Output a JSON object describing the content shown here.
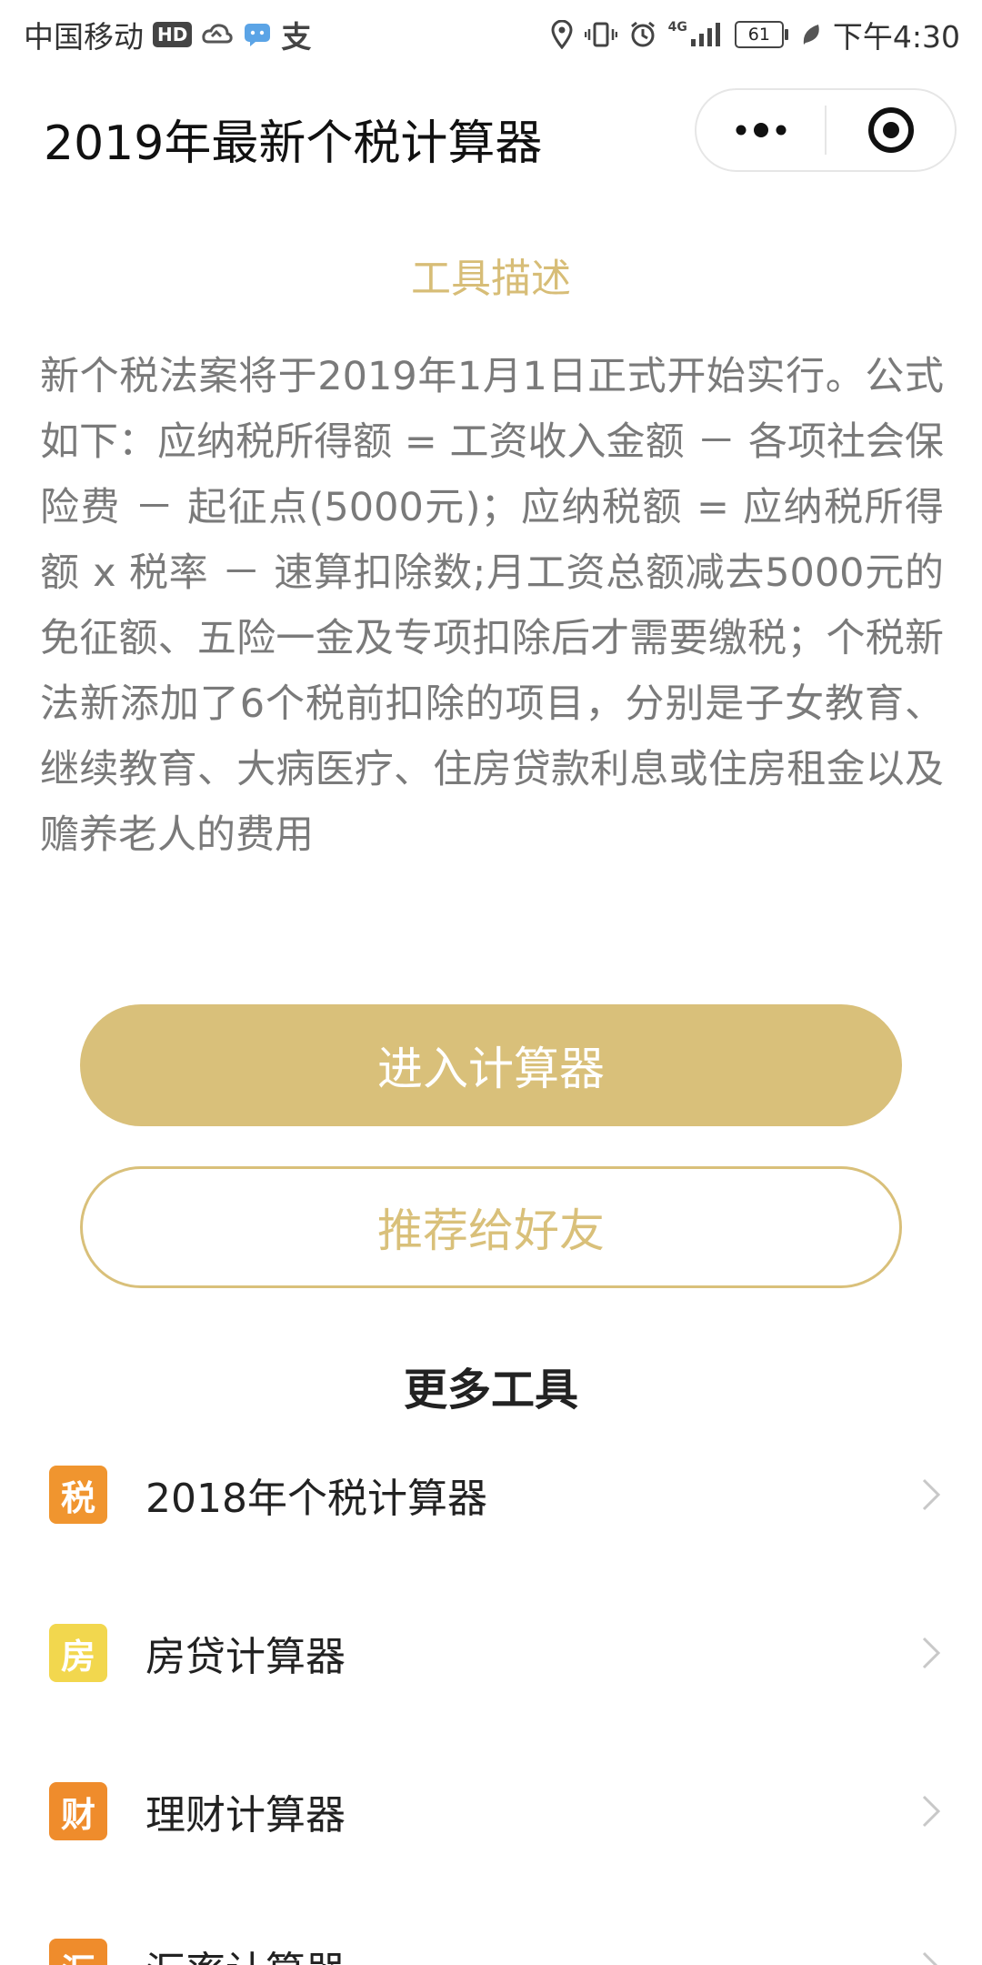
{
  "status_bar": {
    "carrier": "中国移动",
    "hd": "HD",
    "pay_icon_text": "支",
    "network": "4G",
    "battery": "61",
    "time": "下午4:30"
  },
  "header": {
    "title": "2019年最新个税计算器",
    "menu_icon": "more-dots-icon",
    "close_icon": "target-close-icon"
  },
  "description": {
    "title": "工具描述",
    "body": "新个税法案将于2019年1月1日正式开始实行。公式如下：应纳税所得额 = 工资收入金额 － 各项社会保险费 － 起征点(5000元)；应纳税额 = 应纳税所得额 x 税率 － 速算扣除数;月工资总额减去5000元的免征额、五险一金及专项扣除后才需要缴税；个税新法新添加了6个税前扣除的项目，分别是子女教育、继续教育、大病医疗、住房贷款利息或住房租金以及赡养老人的费用"
  },
  "buttons": {
    "primary_label": "进入计算器",
    "share_label": "推荐给好友"
  },
  "more_tools": {
    "title": "更多工具",
    "items": [
      {
        "badge": "税",
        "label": "2018年个税计算器",
        "color": "#f0952f"
      },
      {
        "badge": "房",
        "label": "房贷计算器",
        "color": "#f2d74e"
      },
      {
        "badge": "财",
        "label": "理财计算器",
        "color": "#ef8c2c"
      },
      {
        "badge": "汇",
        "label": "汇率计算器",
        "color": "#ef8c2c"
      }
    ]
  },
  "colors": {
    "accent": "#d9c07a",
    "desc_text": "#7a7a7a"
  }
}
